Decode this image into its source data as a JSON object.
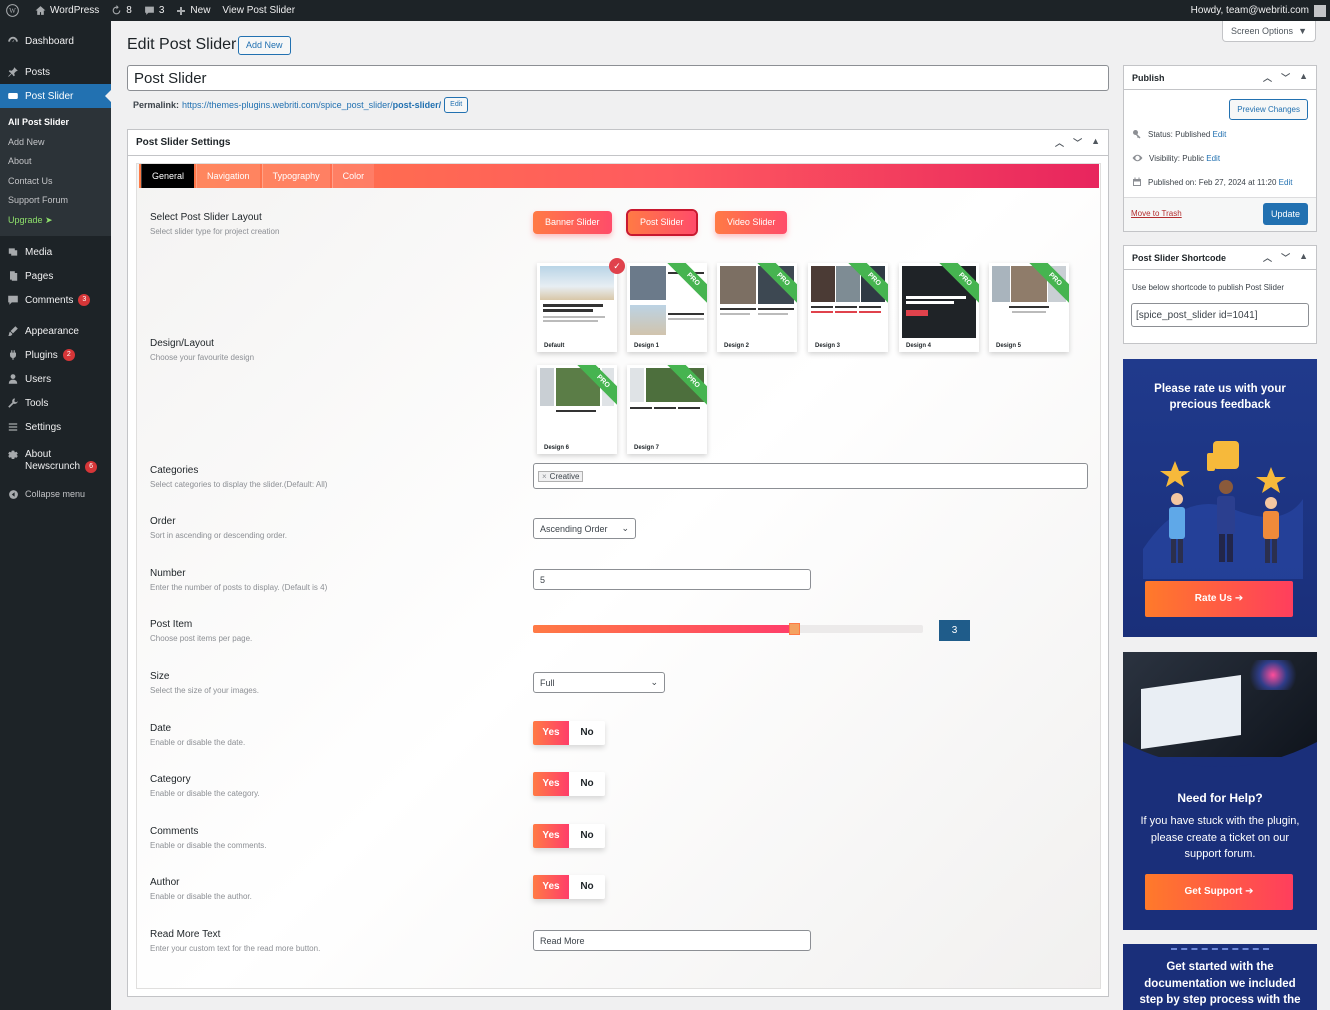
{
  "adminbar": {
    "site": "WordPress",
    "updates": "8",
    "comments": "3",
    "new": "New",
    "view": "View Post Slider",
    "howdy": "Howdy, team@webriti.com"
  },
  "sidebar": {
    "dashboard": "Dashboard",
    "posts": "Posts",
    "post_slider": "Post Slider",
    "sub": [
      "All Post Slider",
      "Add New",
      "About",
      "Contact Us",
      "Support Forum",
      "Upgrade"
    ],
    "media": "Media",
    "pages": "Pages",
    "comments": "Comments",
    "comments_badge": "3",
    "appearance": "Appearance",
    "plugins": "Plugins",
    "plugins_badge": "2",
    "users": "Users",
    "tools": "Tools",
    "settings": "Settings",
    "about_line1": "About",
    "about_line2": "Newscrunch",
    "about_badge": "6",
    "collapse": "Collapse menu"
  },
  "header": {
    "title": "Edit Post Slider",
    "add_new": "Add New",
    "screen_options": "Screen Options"
  },
  "post": {
    "title": "Post Slider",
    "permalink_label": "Permalink:",
    "permalink_base": "https://themes-plugins.webriti.com/spice_post_slider/",
    "permalink_slug": "post-slider/",
    "edit": "Edit"
  },
  "settings": {
    "box_title": "Post Slider Settings",
    "tabs": [
      "General",
      "Navigation",
      "Typography",
      "Color"
    ],
    "layout": {
      "label": "Select Post Slider Layout",
      "desc": "Select slider type for project creation",
      "options": [
        "Banner Slider",
        "Post Slider",
        "Video Slider"
      ],
      "selected": "Post Slider"
    },
    "design": {
      "label": "Design/Layout",
      "desc": "Choose your favourite design",
      "pro": "PRO",
      "cards": [
        "Default",
        "Design 1",
        "Design 2",
        "Design 3",
        "Design 4",
        "Design 5",
        "Design 6",
        "Design 7"
      ],
      "selected": "Default"
    },
    "categories": {
      "label": "Categories",
      "desc": "Select categories to display the slider.(Default: All)",
      "chip": "Creative"
    },
    "order": {
      "label": "Order",
      "desc": "Sort in ascending or descending order.",
      "value": "Ascending Order"
    },
    "number": {
      "label": "Number",
      "desc": "Enter the number of posts to display. (Default is 4)",
      "value": "5"
    },
    "post_item": {
      "label": "Post Item",
      "desc": "Choose post items per page.",
      "value": "3",
      "fill_fraction": 0.67
    },
    "size": {
      "label": "Size",
      "desc": "Select the size of your images.",
      "value": "Full"
    },
    "toggles": [
      {
        "label": "Date",
        "desc": "Enable or disable the date."
      },
      {
        "label": "Category",
        "desc": "Enable or disable the category."
      },
      {
        "label": "Comments",
        "desc": "Enable or disable the comments."
      },
      {
        "label": "Author",
        "desc": "Enable or disable the author."
      }
    ],
    "yes": "Yes",
    "no": "No",
    "read_more": {
      "label": "Read More Text",
      "desc": "Enter your custom text for the read more button.",
      "value": "Read More"
    }
  },
  "publish": {
    "title": "Publish",
    "preview": "Preview Changes",
    "status_label": "Status:",
    "status_value": "Published",
    "visibility_label": "Visibility:",
    "visibility_value": "Public",
    "published_label": "Published on:",
    "published_value": "Feb 27, 2024 at 11:20",
    "edit": "Edit",
    "trash": "Move to Trash",
    "update": "Update"
  },
  "shortcode": {
    "title": "Post Slider Shortcode",
    "desc": "Use below shortcode to publish Post Slider",
    "value": "[spice_post_slider id=1041]"
  },
  "promo1": {
    "heading": "Please rate us with your precious feedback",
    "button": "Rate Us"
  },
  "promo2": {
    "heading": "Need for Help?",
    "text": "If you have stuck with the plugin, please create a ticket on our support forum.",
    "button": "Get Support"
  },
  "promo3": {
    "text": "Get started with the documentation we included step by step process with the"
  },
  "colors": {
    "accent": "#2271b1",
    "gradient_start": "#ff7a45",
    "gradient_end": "#e8255e",
    "pro_green": "#46b450",
    "promo_bg": "#1a2f7a"
  }
}
